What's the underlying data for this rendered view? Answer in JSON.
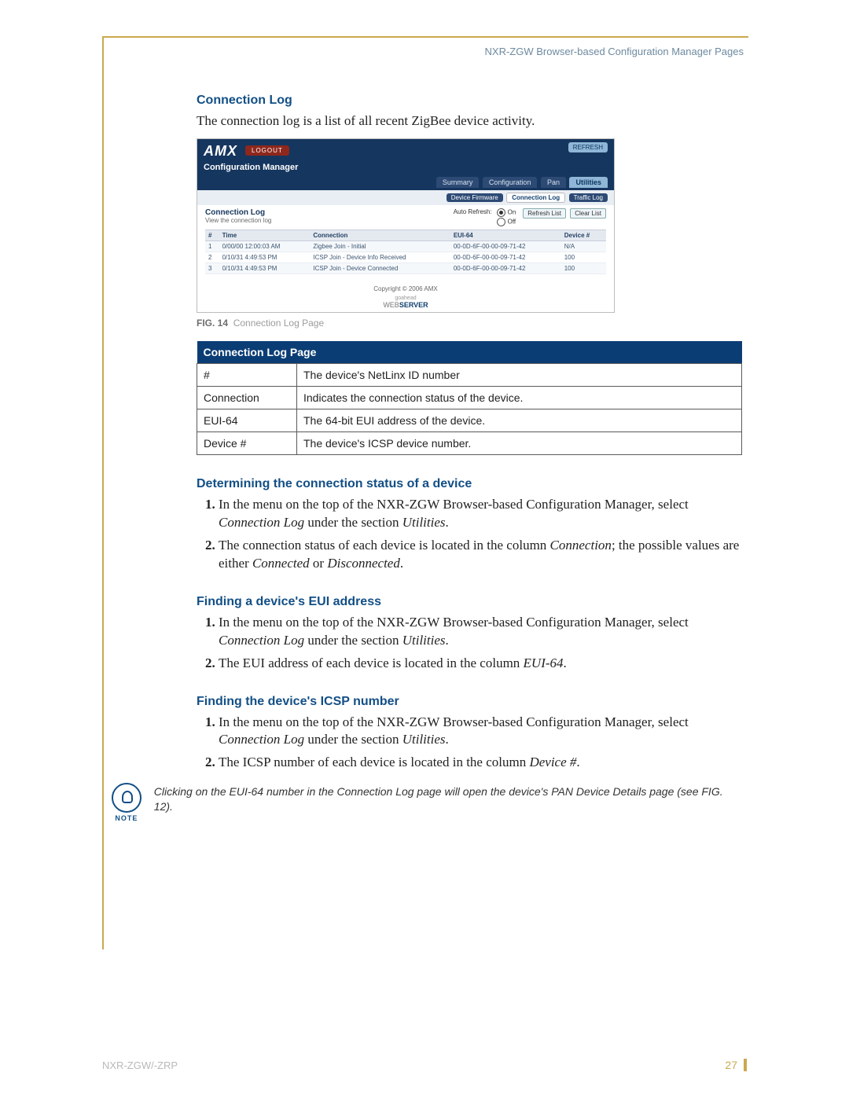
{
  "runningHead": "NXR-ZGW Browser-based Configuration Manager Pages",
  "h_conn": "Connection Log",
  "p_conn": "The connection log is a list of all recent ZigBee device activity.",
  "shot": {
    "logo": "AMX",
    "logout": "LOGOUT",
    "refresh": "REFRESH",
    "subtitle": "Configuration Manager",
    "tabs1": {
      "summary": "Summary",
      "config": "Configuration",
      "pan": "Pan",
      "util": "Utilities"
    },
    "tabs2": {
      "fw": "Device Firmware",
      "cl": "Connection Log",
      "tl": "Traffic Log"
    },
    "panelTitle": "Connection Log",
    "panelSub": "View the connection log",
    "autoRefresh": "Auto Refresh:",
    "on": "On",
    "off": "Off",
    "btnRefresh": "Refresh List",
    "btnClear": "Clear List",
    "cols": {
      "n": "#",
      "time": "Time",
      "conn": "Connection",
      "eui": "EUI-64",
      "dev": "Device #"
    },
    "rows": [
      {
        "n": "1",
        "time": "0/00/00 12:00:03 AM",
        "conn": "Zigbee Join - Initial",
        "eui": "00-0D-6F-00-00-09-71-42",
        "dev": "N/A"
      },
      {
        "n": "2",
        "time": "0/10/31 4:49:53 PM",
        "conn": "ICSP Join - Device Info Received",
        "eui": "00-0D-6F-00-00-09-71-42",
        "dev": "100"
      },
      {
        "n": "3",
        "time": "0/10/31 4:49:53 PM",
        "conn": "ICSP Join - Device Connected",
        "eui": "00-0D-6F-00-00-09-71-42",
        "dev": "100"
      }
    ],
    "copyright": "Copyright © 2006 AMX",
    "goahead": "goahead",
    "ws1": "WEB",
    "ws2": "SERVER"
  },
  "caption_fig": "FIG. 14",
  "caption_txt": "Connection Log Page",
  "defs_title": "Connection Log Page",
  "defs": [
    {
      "k": "#",
      "v": "The device's NetLinx ID number"
    },
    {
      "k": "Connection",
      "v": "Indicates the connection status of the device."
    },
    {
      "k": "EUI-64",
      "v": "The 64-bit EUI address of the device."
    },
    {
      "k": "Device #",
      "v": "The device's ICSP device number."
    }
  ],
  "h_det": "Determining the connection status of a device",
  "det_1a": "In the menu on the top of the NXR-ZGW Browser-based Configuration Manager, select ",
  "det_1b": "Connection Log",
  "det_1c": " under the section ",
  "det_1d": "Utilities",
  "det_1e": ".",
  "det_2a": "The connection status of each device is located in the column ",
  "det_2b": "Connection",
  "det_2c": "; the possible values are either ",
  "det_2d": "Connected",
  "det_2e": " or ",
  "det_2f": "Disconnected",
  "det_2g": ".",
  "h_eui": "Finding a device's EUI address",
  "eui_2a": "The EUI address of each device is located in the column ",
  "eui_2b": "EUI-64",
  "eui_2c": ".",
  "h_icsp": "Finding the device's ICSP number",
  "icsp_2a": "The ICSP number of each device is located in the column ",
  "icsp_2b": "Device #",
  "icsp_2c": ".",
  "note_label": "NOTE",
  "note": "Clicking on the EUI-64 number in the Connection Log page will open the device's PAN Device Details page (see FIG. 12).",
  "footer_left": "NXR-ZGW/-ZRP",
  "footer_page": "27"
}
